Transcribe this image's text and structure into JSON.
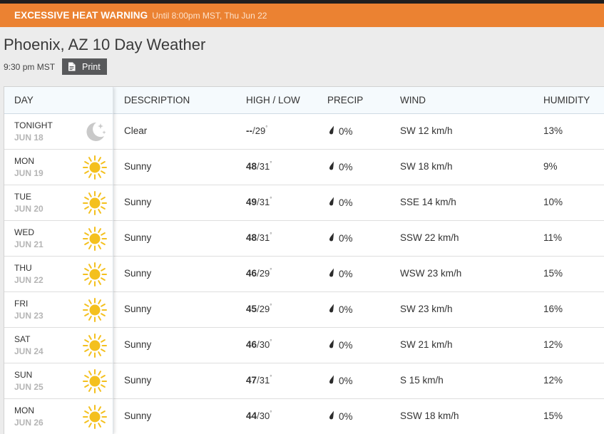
{
  "alert": {
    "title": "EXCESSIVE HEAT WARNING",
    "subtitle": "Until 8:00pm MST, Thu Jun 22",
    "color": "#eb8232"
  },
  "page": {
    "title": "Phoenix, AZ 10 Day Weather",
    "time": "9:30 pm MST",
    "print_label": "Print",
    "print_icon": "document-icon"
  },
  "table": {
    "headers": {
      "day": "DAY",
      "description": "DESCRIPTION",
      "high_low": "HIGH / LOW",
      "precip": "PRECIP",
      "wind": "WIND",
      "humidity": "HUMIDITY"
    },
    "rows": [
      {
        "day": "TONIGHT",
        "date": "JUN 18",
        "icon": "moon-stars-icon",
        "description": "Clear",
        "high": "--",
        "low": "29",
        "precip": "0%",
        "wind": "SW 12 km/h",
        "humidity": "13%"
      },
      {
        "day": "MON",
        "date": "JUN 19",
        "icon": "sun-icon",
        "description": "Sunny",
        "high": "48",
        "low": "31",
        "precip": "0%",
        "wind": "SW 18 km/h",
        "humidity": "9%"
      },
      {
        "day": "TUE",
        "date": "JUN 20",
        "icon": "sun-icon",
        "description": "Sunny",
        "high": "49",
        "low": "31",
        "precip": "0%",
        "wind": "SSE 14 km/h",
        "humidity": "10%"
      },
      {
        "day": "WED",
        "date": "JUN 21",
        "icon": "sun-icon",
        "description": "Sunny",
        "high": "48",
        "low": "31",
        "precip": "0%",
        "wind": "SSW 22 km/h",
        "humidity": "11%"
      },
      {
        "day": "THU",
        "date": "JUN 22",
        "icon": "sun-icon",
        "description": "Sunny",
        "high": "46",
        "low": "29",
        "precip": "0%",
        "wind": "WSW 23 km/h",
        "humidity": "15%"
      },
      {
        "day": "FRI",
        "date": "JUN 23",
        "icon": "sun-icon",
        "description": "Sunny",
        "high": "45",
        "low": "29",
        "precip": "0%",
        "wind": "SW 23 km/h",
        "humidity": "16%"
      },
      {
        "day": "SAT",
        "date": "JUN 24",
        "icon": "sun-icon",
        "description": "Sunny",
        "high": "46",
        "low": "30",
        "precip": "0%",
        "wind": "SW 21 km/h",
        "humidity": "12%"
      },
      {
        "day": "SUN",
        "date": "JUN 25",
        "icon": "sun-icon",
        "description": "Sunny",
        "high": "47",
        "low": "31",
        "precip": "0%",
        "wind": "S 15 km/h",
        "humidity": "12%"
      },
      {
        "day": "MON",
        "date": "JUN 26",
        "icon": "sun-icon",
        "description": "Sunny",
        "high": "44",
        "low": "30",
        "precip": "0%",
        "wind": "SSW 18 km/h",
        "humidity": "15%"
      }
    ]
  },
  "colors": {
    "sun": "#f4c01e",
    "moon": "#c9c9c9",
    "print_button": "#58595b",
    "date_text": "#b5b5b5"
  }
}
